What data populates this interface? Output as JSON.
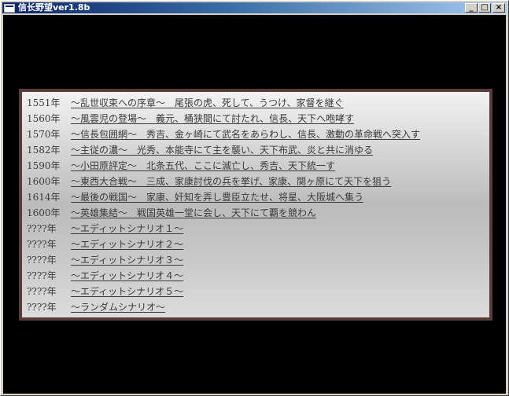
{
  "window": {
    "title": "信长野望ver1.8b",
    "buttons": {
      "minimize": "_",
      "maximize": "□",
      "close": "×"
    }
  },
  "menu": {
    "items": [
      {
        "year": "1551年",
        "text": "～乱世収束への序章～　尾張の虎、死して、うつけ、家督を継ぐ"
      },
      {
        "year": "1560年",
        "text": "～風雲児の登場～　義元、桶狭間にて討たれ、信長、天下へ咆哮す"
      },
      {
        "year": "1570年",
        "text": "～信長包囲網～　秀吉、金ヶ崎にて武名をあらわし、信長、激動の革命戦へ突入す"
      },
      {
        "year": "1582年",
        "text": "～主従の濃～　光秀、本能寺にて主を襲い、天下布武、炎と共に消ゆる"
      },
      {
        "year": "1590年",
        "text": "～小田原評定～　北条五代、ここに滅亡し、秀吉、天下統一す"
      },
      {
        "year": "1600年",
        "text": "～東西大合戦～　三成、家康討伐の兵を挙げ、家康、関ヶ原にて天下を狙う"
      },
      {
        "year": "1614年",
        "text": "～最後の戦国～　家康、奸知を弄し豊臣立たせ、将星、大阪城へ集う"
      },
      {
        "year": "1600年",
        "text": "～英雄集結～　戦国英雄一堂に会し、天下にて覇を競わん"
      },
      {
        "year": "????年",
        "text": "～エディットシナリオ１～"
      },
      {
        "year": "????年",
        "text": "～エディットシナリオ２～"
      },
      {
        "year": "????年",
        "text": "～エディットシナリオ３～"
      },
      {
        "year": "????年",
        "text": "～エディットシナリオ４～"
      },
      {
        "year": "????年",
        "text": "～エディットシナリオ５～"
      },
      {
        "year": "????年",
        "text": "～ランダムシナリオ～"
      }
    ]
  },
  "colors": {
    "titlebar_start": "#0a246a",
    "titlebar_end": "#a6caf0",
    "client_bg": "#000000",
    "panel_border": "#5a3c36",
    "menu_text": "#3a3a3a"
  }
}
